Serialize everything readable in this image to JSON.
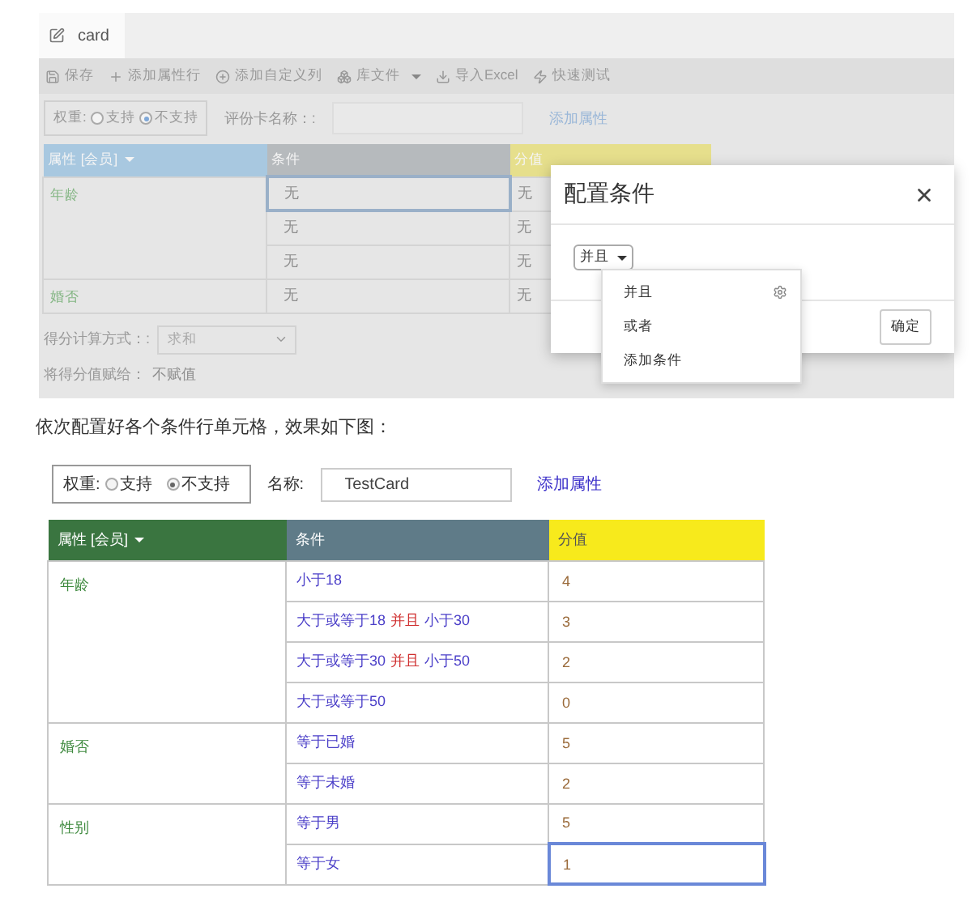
{
  "editor_screenshot": {
    "tab": {
      "label": "card"
    },
    "toolbar": [
      {
        "kind": "save",
        "label": "保存",
        "dropdown": false
      },
      {
        "kind": "add",
        "label": "添加属性行",
        "dropdown": false
      },
      {
        "kind": "add-column",
        "label": "添加自定义列",
        "dropdown": false
      },
      {
        "kind": "library",
        "label": "库文件",
        "dropdown": true
      },
      {
        "kind": "import",
        "label": "导入Excel",
        "dropdown": false
      },
      {
        "kind": "test",
        "label": "快速测试",
        "dropdown": false
      }
    ],
    "weight": {
      "label": "权重:",
      "options": [
        {
          "label": "支持",
          "selected": false
        },
        {
          "label": "不支持",
          "selected": true
        }
      ]
    },
    "name_label": "评份卡名称：:",
    "add_attribute": "添加属性",
    "table": {
      "columns": [
        "属性 [会员]",
        "条件",
        "分值"
      ],
      "groups": [
        {
          "attribute": "年龄",
          "rows": [
            {
              "condition": "无",
              "score": "无",
              "selected": true
            },
            {
              "condition": "无",
              "score": "无",
              "selected": false
            },
            {
              "condition": "无",
              "score": "无",
              "selected": false
            }
          ]
        },
        {
          "attribute": "婚否",
          "rows": [
            {
              "condition": "无",
              "score": "无",
              "selected": false
            }
          ]
        }
      ]
    },
    "score_method": {
      "label": "得分计算方式：:",
      "value": "求和"
    },
    "assign": {
      "label": "将得分值赋给：",
      "value": "不赋值"
    },
    "dialog": {
      "title": "配置条件",
      "trigger": "并且",
      "menu": [
        {
          "label": "并且",
          "gear": true
        },
        {
          "label": "或者",
          "gear": false
        },
        {
          "label": "添加条件",
          "gear": false
        }
      ],
      "confirm": "确定"
    }
  },
  "caption": "依次配置好各个条件行单元格，效果如下图：",
  "result_screenshot": {
    "weight": {
      "label": "权重:",
      "options": [
        {
          "label": "支持",
          "selected": false
        },
        {
          "label": "不支持",
          "selected": true
        }
      ]
    },
    "name_label": "名称:",
    "name_value": "TestCard",
    "add_attribute": "添加属性",
    "table": {
      "columns": [
        "属性 [会员]",
        "条件",
        "分值"
      ],
      "groups": [
        {
          "attribute": "年龄",
          "rows": [
            {
              "condition": [
                {
                  "kind": "cond",
                  "text": "小于18"
                }
              ],
              "score": "4",
              "selected": false
            },
            {
              "condition": [
                {
                  "kind": "cond",
                  "text": "大于或等于18"
                },
                {
                  "kind": "op",
                  "text": "并且"
                },
                {
                  "kind": "cond",
                  "text": "小于30"
                }
              ],
              "score": "3",
              "selected": false
            },
            {
              "condition": [
                {
                  "kind": "cond",
                  "text": "大于或等于30"
                },
                {
                  "kind": "op",
                  "text": "并且"
                },
                {
                  "kind": "cond",
                  "text": "小于50"
                }
              ],
              "score": "2",
              "selected": false
            },
            {
              "condition": [
                {
                  "kind": "cond",
                  "text": "大于或等于50"
                }
              ],
              "score": "0",
              "selected": false
            }
          ]
        },
        {
          "attribute": "婚否",
          "rows": [
            {
              "condition": [
                {
                  "kind": "cond",
                  "text": "等于已婚"
                }
              ],
              "score": "5",
              "selected": false
            },
            {
              "condition": [
                {
                  "kind": "cond",
                  "text": "等于未婚"
                }
              ],
              "score": "2",
              "selected": false
            }
          ]
        },
        {
          "attribute": "性别",
          "rows": [
            {
              "condition": [
                {
                  "kind": "cond",
                  "text": "等于男"
                }
              ],
              "score": "5",
              "selected": false
            },
            {
              "condition": [
                {
                  "kind": "cond",
                  "text": "等于女"
                }
              ],
              "score": "1",
              "selected": true
            }
          ]
        }
      ]
    }
  }
}
